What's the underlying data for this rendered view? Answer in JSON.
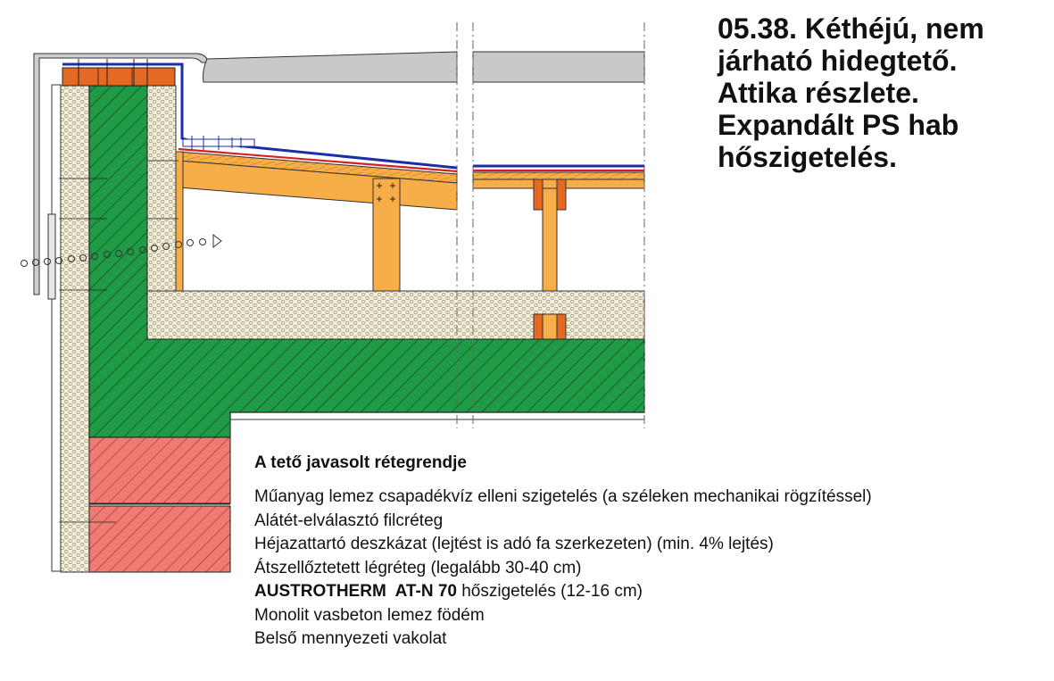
{
  "title_lines": [
    "05.38. Kéthéjú, nem",
    "járható hidegtető.",
    "Attika részlete.",
    "Expandált PS hab",
    "hőszigetelés."
  ],
  "legend": {
    "heading": "A tető javasolt rétegrendje",
    "layers": [
      "Műanyag lemez csapadékvíz elleni szigetelés (a széleken mechanikai rögzítéssel)",
      "Alátét-elválasztó filcréteg",
      "Héjazattartó deszkázat (lejtést is adó fa szerkezeten) (min. 4% lejtés)",
      "Átszellőztetett légréteg (legalább 30-40 cm)",
      "hőszigetelés (12-16 cm)",
      "Monolit vasbeton lemez födém",
      "Belső mennyezeti vakolat"
    ],
    "product_name": "AUSTROTHERM  AT-N 70"
  },
  "colors": {
    "concrete_green": "#1f9a45",
    "insulation_cream": "#f4efd8",
    "timber_orange": "#f7ad48",
    "brick_red": "#ef7b72",
    "plank_orange": "#e46a23",
    "membrane_blue": "#1b2ea8",
    "flashing_gray": "#cfcfcf"
  }
}
